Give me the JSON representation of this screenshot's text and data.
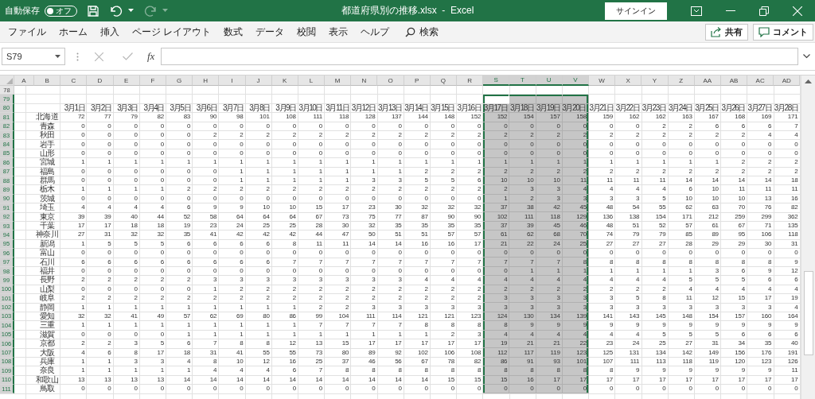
{
  "title_bar": {
    "autosave_label": "自動保存",
    "autosave": {
      "on": false,
      "label": "オフ"
    },
    "redo_disabled": true,
    "title": "都道府県別の推移.xlsx  -  Excel",
    "sign_in": "サインイン"
  },
  "ribbon_tabs": [
    "ファイル",
    "ホーム",
    "挿入",
    "ページ レイアウト",
    "数式",
    "データ",
    "校閲",
    "表示",
    "ヘルプ"
  ],
  "search": "検索",
  "share": "共有",
  "comments": "コメント",
  "formula_bar": {
    "name_box": "S79",
    "function_label": "fx"
  },
  "grid": {
    "columns": [
      {
        "label": "A",
        "selected": false
      },
      {
        "label": "B",
        "selected": false
      },
      {
        "label": "C",
        "selected": false
      },
      {
        "label": "D",
        "selected": false
      },
      {
        "label": "E",
        "selected": false
      },
      {
        "label": "F",
        "selected": false
      },
      {
        "label": "G",
        "selected": false
      },
      {
        "label": "H",
        "selected": false
      },
      {
        "label": "I",
        "selected": false
      },
      {
        "label": "J",
        "selected": false
      },
      {
        "label": "K",
        "selected": false
      },
      {
        "label": "L",
        "selected": false
      },
      {
        "label": "M",
        "selected": false
      },
      {
        "label": "N",
        "selected": false
      },
      {
        "label": "O",
        "selected": false
      },
      {
        "label": "P",
        "selected": false
      },
      {
        "label": "Q",
        "selected": false
      },
      {
        "label": "R",
        "selected": false
      },
      {
        "label": "S",
        "selected": true
      },
      {
        "label": "T",
        "selected": true
      },
      {
        "label": "U",
        "selected": true
      },
      {
        "label": "V",
        "selected": true
      },
      {
        "label": "W",
        "selected": false
      },
      {
        "label": "X",
        "selected": false
      },
      {
        "label": "Y",
        "selected": false
      },
      {
        "label": "Z",
        "selected": false
      },
      {
        "label": "AA",
        "selected": false
      },
      {
        "label": "AB",
        "selected": false
      },
      {
        "label": "AC",
        "selected": false
      },
      {
        "label": "AD",
        "selected": false
      }
    ],
    "rows": [
      {
        "number": "78",
        "selected": false
      },
      {
        "number": "79",
        "selected": true
      },
      {
        "number": "80",
        "selected": true,
        "cells": [
          "3月1日",
          "3月2日",
          "3月3日",
          "3月4日",
          "3月5日",
          "3月6日",
          "3月7日",
          "3月8日",
          "3月9日",
          "3月10日",
          "3月11日",
          "3月12日",
          "3月13日",
          "3月14日",
          "3月15日",
          "3月16日",
          "3月17日",
          "3月18日",
          "3月19日",
          "3月20日",
          "3月21日",
          "3月22日",
          "3月23日",
          "3月24日",
          "3月25日",
          "3月26日",
          "3月27日",
          "3月28日"
        ]
      },
      {
        "number": "81",
        "selected": true,
        "label": "北海道",
        "cells": [
          "72",
          "77",
          "79",
          "82",
          "83",
          "90",
          "98",
          "101",
          "108",
          "111",
          "118",
          "128",
          "137",
          "144",
          "148",
          "152",
          "152",
          "154",
          "157",
          "158",
          "159",
          "162",
          "162",
          "163",
          "167",
          "168",
          "169",
          "171"
        ]
      },
      {
        "number": "82",
        "selected": true,
        "label": "青森",
        "cells": [
          "0",
          "0",
          "0",
          "0",
          "0",
          "0",
          "0",
          "0",
          "0",
          "0",
          "0",
          "0",
          "0",
          "0",
          "0",
          "0",
          "0",
          "0",
          "0",
          "0",
          "0",
          "0",
          "2",
          "2",
          "6",
          "6",
          "6",
          "7"
        ]
      },
      {
        "number": "83",
        "selected": true,
        "label": "秋田",
        "cells": [
          "0",
          "0",
          "0",
          "0",
          "0",
          "2",
          "2",
          "2",
          "2",
          "2",
          "2",
          "2",
          "2",
          "2",
          "2",
          "2",
          "2",
          "2",
          "2",
          "2",
          "2",
          "2",
          "2",
          "2",
          "2",
          "2",
          "4",
          "4"
        ]
      },
      {
        "number": "84",
        "selected": true,
        "label": "岩手",
        "cells": [
          "0",
          "0",
          "0",
          "0",
          "0",
          "0",
          "0",
          "0",
          "0",
          "0",
          "0",
          "0",
          "0",
          "0",
          "0",
          "0",
          "0",
          "0",
          "0",
          "0",
          "0",
          "0",
          "0",
          "0",
          "0",
          "0",
          "0",
          "0"
        ]
      },
      {
        "number": "85",
        "selected": true,
        "label": "山形",
        "cells": [
          "0",
          "0",
          "0",
          "0",
          "0",
          "0",
          "0",
          "0",
          "0",
          "0",
          "0",
          "0",
          "0",
          "0",
          "0",
          "0",
          "0",
          "0",
          "0",
          "0",
          "0",
          "0",
          "0",
          "0",
          "0",
          "0",
          "0",
          "0"
        ]
      },
      {
        "number": "86",
        "selected": true,
        "label": "宮城",
        "cells": [
          "1",
          "1",
          "1",
          "1",
          "1",
          "1",
          "1",
          "1",
          "1",
          "1",
          "1",
          "1",
          "1",
          "1",
          "1",
          "1",
          "1",
          "1",
          "1",
          "1",
          "1",
          "1",
          "1",
          "1",
          "1",
          "2",
          "2",
          "2"
        ]
      },
      {
        "number": "87",
        "selected": true,
        "label": "福島",
        "cells": [
          "0",
          "0",
          "0",
          "0",
          "0",
          "0",
          "1",
          "1",
          "1",
          "1",
          "1",
          "1",
          "1",
          "2",
          "2",
          "2",
          "2",
          "2",
          "2",
          "2",
          "2",
          "2",
          "2",
          "2",
          "2",
          "2",
          "2",
          "2"
        ]
      },
      {
        "number": "88",
        "selected": true,
        "label": "群馬",
        "cells": [
          "0",
          "0",
          "0",
          "0",
          "0",
          "0",
          "1",
          "1",
          "1",
          "1",
          "1",
          "3",
          "3",
          "5",
          "5",
          "6",
          "10",
          "10",
          "10",
          "11",
          "11",
          "11",
          "11",
          "14",
          "14",
          "14",
          "14",
          "18"
        ]
      },
      {
        "number": "89",
        "selected": true,
        "label": "栃木",
        "cells": [
          "1",
          "1",
          "1",
          "1",
          "2",
          "2",
          "2",
          "2",
          "2",
          "2",
          "2",
          "2",
          "2",
          "2",
          "2",
          "2",
          "2",
          "3",
          "3",
          "4",
          "4",
          "4",
          "4",
          "6",
          "10",
          "11",
          "11",
          "11"
        ]
      },
      {
        "number": "90",
        "selected": true,
        "label": "茨城",
        "cells": [
          "0",
          "0",
          "0",
          "0",
          "0",
          "0",
          "0",
          "0",
          "0",
          "0",
          "0",
          "0",
          "0",
          "0",
          "0",
          "0",
          "1",
          "2",
          "3",
          "3",
          "3",
          "3",
          "5",
          "10",
          "10",
          "10",
          "13",
          "16"
        ]
      },
      {
        "number": "91",
        "selected": true,
        "label": "埼玉",
        "cells": [
          "4",
          "4",
          "4",
          "4",
          "6",
          "9",
          "9",
          "10",
          "10",
          "15",
          "17",
          "23",
          "30",
          "32",
          "32",
          "32",
          "37",
          "38",
          "42",
          "45",
          "48",
          "54",
          "55",
          "62",
          "63",
          "70",
          "76",
          "82"
        ]
      },
      {
        "number": "92",
        "selected": true,
        "label": "東京",
        "cells": [
          "39",
          "39",
          "40",
          "44",
          "52",
          "58",
          "64",
          "64",
          "64",
          "67",
          "73",
          "75",
          "77",
          "87",
          "90",
          "90",
          "102",
          "111",
          "118",
          "129",
          "136",
          "138",
          "154",
          "171",
          "212",
          "259",
          "299",
          "362"
        ]
      },
      {
        "number": "93",
        "selected": true,
        "label": "千葉",
        "cells": [
          "17",
          "17",
          "18",
          "18",
          "19",
          "23",
          "24",
          "25",
          "25",
          "28",
          "30",
          "32",
          "35",
          "35",
          "35",
          "35",
          "37",
          "39",
          "45",
          "46",
          "48",
          "51",
          "52",
          "57",
          "61",
          "67",
          "71",
          "135"
        ]
      },
      {
        "number": "94",
        "selected": true,
        "label": "神奈川",
        "cells": [
          "27",
          "31",
          "32",
          "32",
          "35",
          "41",
          "42",
          "42",
          "42",
          "44",
          "47",
          "50",
          "51",
          "51",
          "57",
          "57",
          "61",
          "62",
          "68",
          "70",
          "74",
          "79",
          "79",
          "85",
          "89",
          "95",
          "106",
          "118"
        ]
      },
      {
        "number": "95",
        "selected": true,
        "label": "新潟",
        "cells": [
          "1",
          "5",
          "5",
          "5",
          "6",
          "6",
          "6",
          "6",
          "8",
          "11",
          "11",
          "14",
          "14",
          "16",
          "16",
          "17",
          "21",
          "22",
          "24",
          "25",
          "27",
          "27",
          "27",
          "28",
          "29",
          "29",
          "30",
          "31"
        ]
      },
      {
        "number": "96",
        "selected": true,
        "label": "富山",
        "cells": [
          "0",
          "0",
          "0",
          "0",
          "0",
          "0",
          "0",
          "0",
          "0",
          "0",
          "0",
          "0",
          "0",
          "0",
          "0",
          "0",
          "0",
          "0",
          "0",
          "0",
          "0",
          "0",
          "0",
          "0",
          "0",
          "0",
          "0",
          "0"
        ]
      },
      {
        "number": "97",
        "selected": true,
        "label": "石川",
        "cells": [
          "6",
          "6",
          "6",
          "6",
          "6",
          "6",
          "6",
          "6",
          "7",
          "7",
          "7",
          "7",
          "7",
          "7",
          "7",
          "7",
          "7",
          "7",
          "7",
          "8",
          "8",
          "8",
          "8",
          "8",
          "8",
          "8",
          "8",
          "9"
        ]
      },
      {
        "number": "98",
        "selected": true,
        "label": "福井",
        "cells": [
          "0",
          "0",
          "0",
          "0",
          "0",
          "0",
          "0",
          "0",
          "0",
          "0",
          "0",
          "0",
          "0",
          "0",
          "0",
          "0",
          "0",
          "1",
          "1",
          "1",
          "1",
          "1",
          "1",
          "1",
          "3",
          "6",
          "9",
          "12"
        ]
      },
      {
        "number": "99",
        "selected": true,
        "label": "長野",
        "cells": [
          "2",
          "2",
          "2",
          "2",
          "2",
          "3",
          "3",
          "3",
          "3",
          "3",
          "3",
          "3",
          "3",
          "4",
          "4",
          "4",
          "4",
          "4",
          "4",
          "4",
          "4",
          "4",
          "4",
          "5",
          "5",
          "5",
          "6",
          "6"
        ]
      },
      {
        "number": "100",
        "selected": true,
        "label": "山梨",
        "cells": [
          "0",
          "0",
          "0",
          "0",
          "0",
          "1",
          "2",
          "2",
          "2",
          "2",
          "2",
          "2",
          "2",
          "2",
          "2",
          "2",
          "2",
          "2",
          "2",
          "2",
          "2",
          "2",
          "2",
          "4",
          "4",
          "4",
          "4",
          "4"
        ]
      },
      {
        "number": "101",
        "selected": true,
        "label": "岐阜",
        "cells": [
          "2",
          "2",
          "2",
          "2",
          "2",
          "2",
          "2",
          "2",
          "2",
          "2",
          "2",
          "2",
          "2",
          "2",
          "2",
          "2",
          "3",
          "3",
          "3",
          "3",
          "3",
          "5",
          "8",
          "11",
          "12",
          "15",
          "17",
          "19"
        ]
      },
      {
        "number": "102",
        "selected": true,
        "label": "静岡",
        "cells": [
          "1",
          "1",
          "1",
          "1",
          "1",
          "1",
          "1",
          "1",
          "1",
          "2",
          "2",
          "3",
          "3",
          "3",
          "3",
          "3",
          "3",
          "3",
          "3",
          "3",
          "3",
          "3",
          "3",
          "3",
          "3",
          "3",
          "3",
          "4"
        ]
      },
      {
        "number": "103",
        "selected": true,
        "label": "愛知",
        "cells": [
          "32",
          "32",
          "41",
          "49",
          "57",
          "62",
          "69",
          "80",
          "86",
          "99",
          "104",
          "111",
          "114",
          "121",
          "121",
          "123",
          "124",
          "130",
          "134",
          "139",
          "141",
          "143",
          "145",
          "148",
          "154",
          "157",
          "160",
          "164"
        ]
      },
      {
        "number": "104",
        "selected": true,
        "label": "三重",
        "cells": [
          "1",
          "1",
          "1",
          "1",
          "1",
          "1",
          "1",
          "1",
          "1",
          "7",
          "7",
          "7",
          "7",
          "8",
          "8",
          "8",
          "8",
          "9",
          "9",
          "9",
          "9",
          "9",
          "9",
          "9",
          "9",
          "9",
          "9",
          "9"
        ]
      },
      {
        "number": "105",
        "selected": true,
        "label": "滋賀",
        "cells": [
          "0",
          "0",
          "0",
          "0",
          "1",
          "1",
          "1",
          "1",
          "1",
          "1",
          "1",
          "1",
          "1",
          "1",
          "2",
          "3",
          "4",
          "4",
          "4",
          "4",
          "4",
          "4",
          "5",
          "5",
          "5",
          "6",
          "6",
          "6"
        ]
      },
      {
        "number": "106",
        "selected": true,
        "label": "京都",
        "cells": [
          "2",
          "2",
          "3",
          "5",
          "6",
          "7",
          "8",
          "8",
          "12",
          "13",
          "15",
          "17",
          "17",
          "17",
          "17",
          "17",
          "19",
          "21",
          "21",
          "22",
          "23",
          "24",
          "25",
          "27",
          "31",
          "34",
          "35",
          "40"
        ]
      },
      {
        "number": "107",
        "selected": true,
        "label": "大阪",
        "cells": [
          "4",
          "6",
          "8",
          "17",
          "18",
          "31",
          "41",
          "55",
          "55",
          "73",
          "80",
          "89",
          "92",
          "102",
          "106",
          "108",
          "112",
          "117",
          "119",
          "123",
          "125",
          "131",
          "134",
          "142",
          "149",
          "156",
          "176",
          "191"
        ]
      },
      {
        "number": "108",
        "selected": true,
        "label": "兵庫",
        "cells": [
          "1",
          "1",
          "3",
          "3",
          "4",
          "8",
          "10",
          "12",
          "16",
          "25",
          "37",
          "46",
          "56",
          "67",
          "78",
          "82",
          "86",
          "91",
          "93",
          "101",
          "107",
          "111",
          "113",
          "118",
          "119",
          "120",
          "123",
          "126"
        ]
      },
      {
        "number": "109",
        "selected": true,
        "label": "奈良",
        "cells": [
          "1",
          "1",
          "1",
          "1",
          "1",
          "4",
          "4",
          "4",
          "6",
          "7",
          "8",
          "8",
          "8",
          "8",
          "8",
          "8",
          "8",
          "8",
          "8",
          "8",
          "8",
          "9",
          "9",
          "9",
          "9",
          "9",
          "9",
          "11"
        ]
      },
      {
        "number": "110",
        "selected": true,
        "label": "和歌山",
        "cells": [
          "13",
          "13",
          "13",
          "13",
          "14",
          "14",
          "14",
          "14",
          "14",
          "14",
          "14",
          "14",
          "14",
          "14",
          "15",
          "15",
          "15",
          "16",
          "17",
          "17",
          "17",
          "17",
          "17",
          "17",
          "17",
          "17",
          "17",
          "17"
        ]
      },
      {
        "number": "111",
        "selected": true,
        "label": "鳥取",
        "cells": [
          "0",
          "0",
          "0",
          "0",
          "0",
          "0",
          "0",
          "0",
          "0",
          "0",
          "0",
          "0",
          "0",
          "0",
          "0",
          "0",
          "0",
          "0",
          "0",
          "0",
          "0",
          "0",
          "0",
          "0",
          "0",
          "0",
          "0",
          "0"
        ]
      }
    ]
  }
}
